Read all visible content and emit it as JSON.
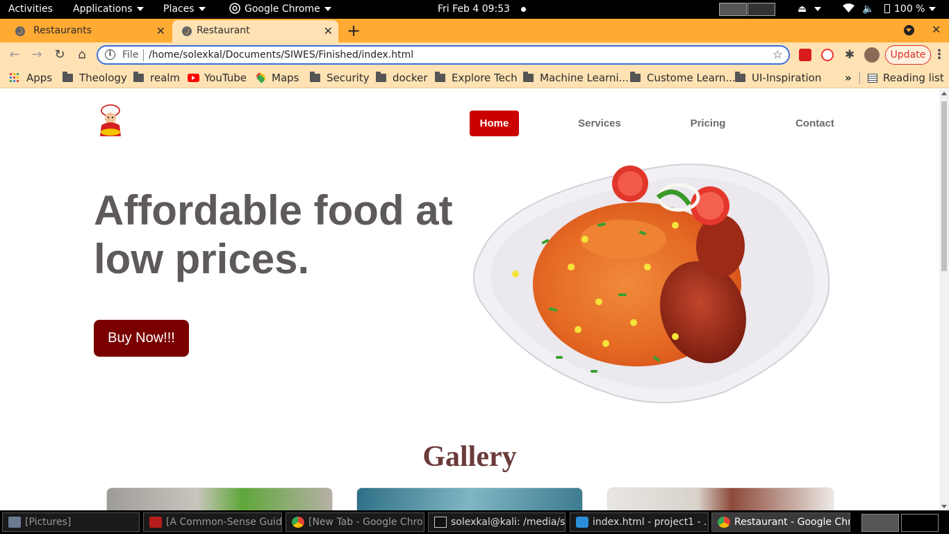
{
  "topbar": {
    "activities": "Activities",
    "applications": "Applications",
    "places": "Places",
    "app_name": "Google Chrome",
    "clock": "Fri Feb 4  09:53",
    "battery": "100 %"
  },
  "tabs": [
    {
      "title": "Restaurants",
      "active": false
    },
    {
      "title": "Restaurant",
      "active": true
    }
  ],
  "toolbar": {
    "scheme": "File",
    "url": "/home/solexkal/Documents/SIWES/Finished/index.html",
    "update_label": "Update"
  },
  "bookmarks": [
    {
      "label": "Apps",
      "icon": "apps-grid-icon"
    },
    {
      "label": "Theology",
      "icon": "folder-icon"
    },
    {
      "label": "realm",
      "icon": "folder-icon"
    },
    {
      "label": "YouTube",
      "icon": "youtube-icon"
    },
    {
      "label": "Maps",
      "icon": "maps-icon"
    },
    {
      "label": "Security",
      "icon": "folder-icon"
    },
    {
      "label": "docker",
      "icon": "folder-icon"
    },
    {
      "label": "Explore Tech",
      "icon": "folder-icon"
    },
    {
      "label": "Machine Learni...",
      "icon": "folder-icon"
    },
    {
      "label": "Custome Learn...",
      "icon": "folder-icon"
    },
    {
      "label": "UI-Inspiration",
      "icon": "folder-icon"
    }
  ],
  "reading_list": "Reading list",
  "page": {
    "nav": {
      "home": "Home",
      "services": "Services",
      "pricing": "Pricing",
      "contact": "Contact"
    },
    "hero_title": "Affordable food at low prices.",
    "cta": "Buy Now!!!",
    "gallery_title": "Gallery"
  },
  "taskbar": [
    {
      "label": "[Pictures]"
    },
    {
      "label": "[A Common-Sense Guid..."
    },
    {
      "label": "[New Tab - Google Chro..."
    },
    {
      "label": "solexkal@kali: /media/s..."
    },
    {
      "label": "index.html - project1 - ..."
    },
    {
      "label": "Restaurant - Google Chr..."
    }
  ],
  "colors": {
    "tab_strip": "#ffaa33",
    "toolbar": "#ffe2b3",
    "nav_active": "#cc0000",
    "cta": "#7a0000",
    "hero_text": "#5f5a5a",
    "gallery_title": "#6b3a3a"
  }
}
